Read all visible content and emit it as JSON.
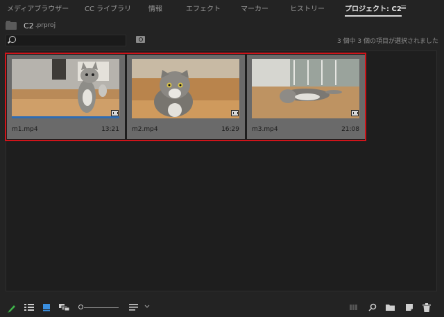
{
  "tabs": [
    {
      "label": "メディアブラウザー",
      "active": false
    },
    {
      "label": "CC ライブラリ",
      "active": false
    },
    {
      "label": "情報",
      "active": false
    },
    {
      "label": "エフェクト",
      "active": false
    },
    {
      "label": "マーカー",
      "active": false
    },
    {
      "label": "ヒストリー",
      "active": false
    },
    {
      "label": "プロジェクト: C2",
      "active": true
    }
  ],
  "project": {
    "name": "C2",
    "ext": ".prproj"
  },
  "search": {
    "value": "",
    "placeholder": ""
  },
  "status": "3 個中 3 個の項目が選択されました",
  "clips": [
    {
      "name": "m1.mp4",
      "duration": "13:21",
      "selected": true
    },
    {
      "name": "m2.mp4",
      "duration": "16:29",
      "selected": true
    },
    {
      "name": "m3.mp4",
      "duration": "21:08",
      "selected": true
    }
  ],
  "zoom_slider": {
    "level": 0.0
  },
  "colors": {
    "selection": "#d0141a",
    "pencil": "#3fb54a",
    "icon_view_active": "#3a8fe0"
  }
}
